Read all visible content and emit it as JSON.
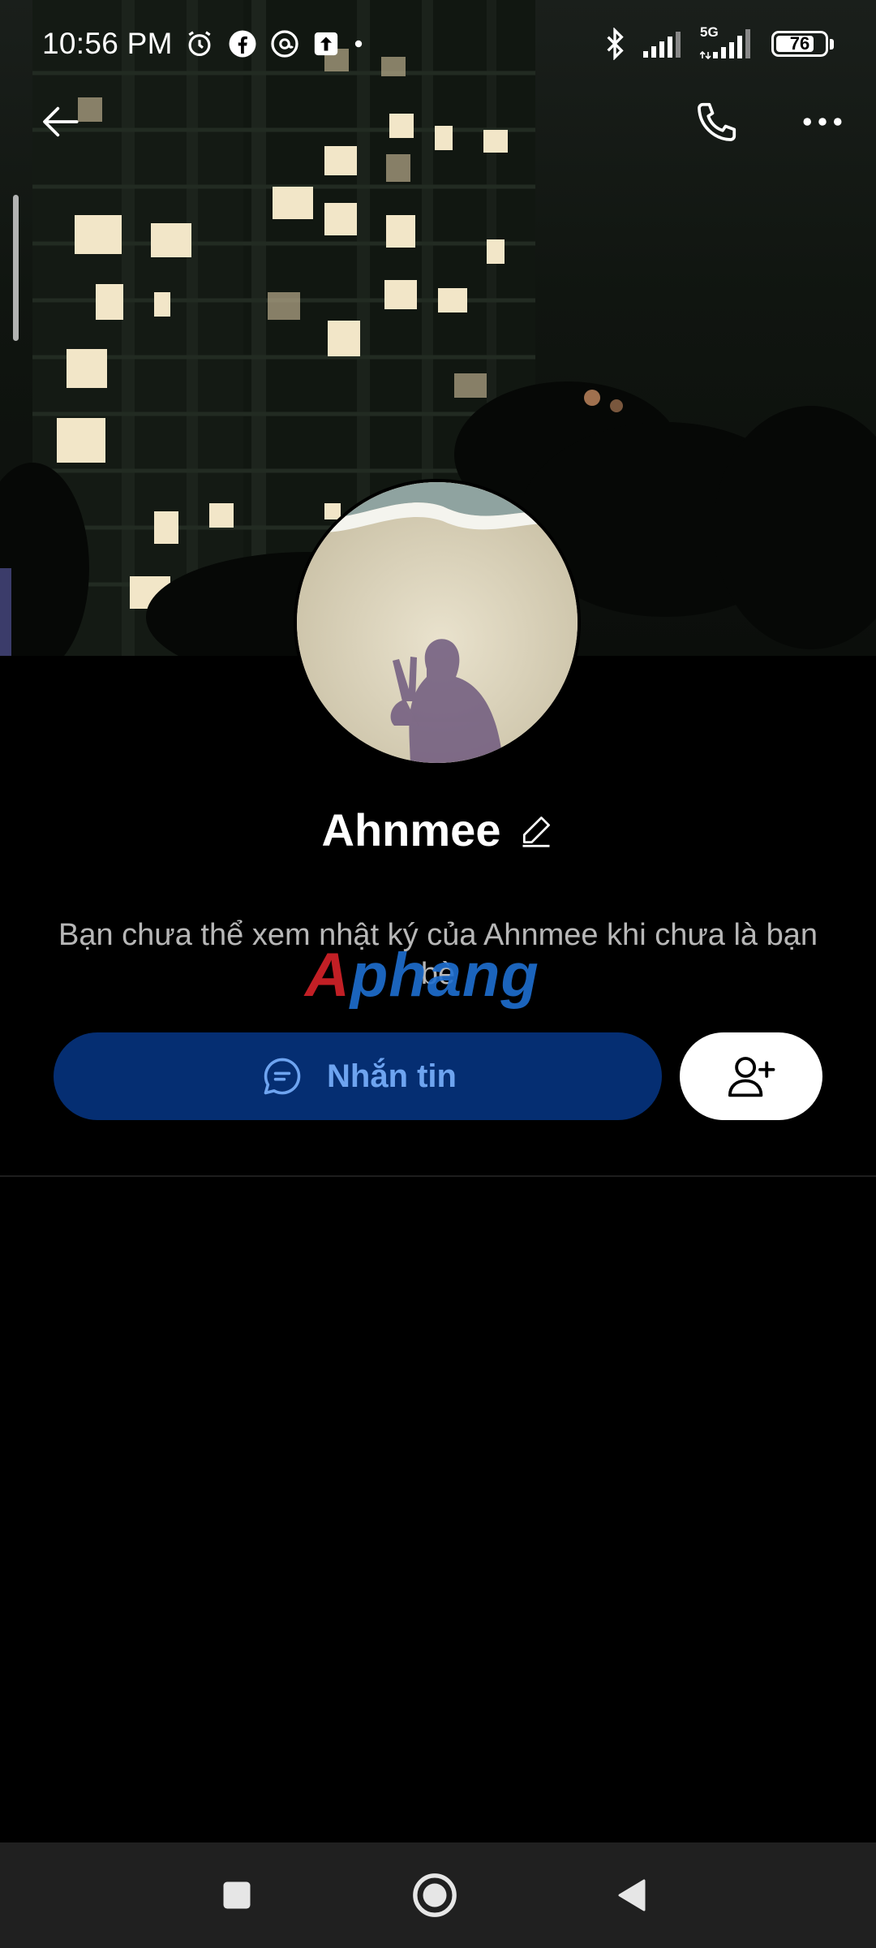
{
  "status_bar": {
    "time": "10:56 PM",
    "left_icons": [
      "alarm-icon",
      "facebook-icon",
      "threads-icon",
      "upload-icon",
      "dot-icon"
    ],
    "right_icons": [
      "bluetooth-icon",
      "signal-icon",
      "5g-signal-icon"
    ],
    "network_label": "5G",
    "battery": "76"
  },
  "header": {
    "back_icon": "arrow-left-icon",
    "call_icon": "phone-icon",
    "more_icon": "more-dots-icon"
  },
  "profile": {
    "name": "Ahnmee",
    "edit_icon": "pencil-icon",
    "privacy_note": "Bạn chưa thể xem nhật ký của Ahnmee khi chưa là bạn bè"
  },
  "watermark": {
    "part_a": "A",
    "part_b": "phang"
  },
  "actions": {
    "message_label": "Nhắn tin",
    "message_icon": "chat-bubble-icon",
    "add_friend_icon": "add-user-icon"
  },
  "nav": {
    "recents_icon": "square-icon",
    "home_icon": "circle-icon",
    "back_icon": "triangle-back-icon"
  },
  "colors": {
    "background": "#000000",
    "message_button": "#052e72",
    "message_text": "#6ea4f0",
    "add_button": "#ffffff",
    "nav_bar": "#202020"
  }
}
